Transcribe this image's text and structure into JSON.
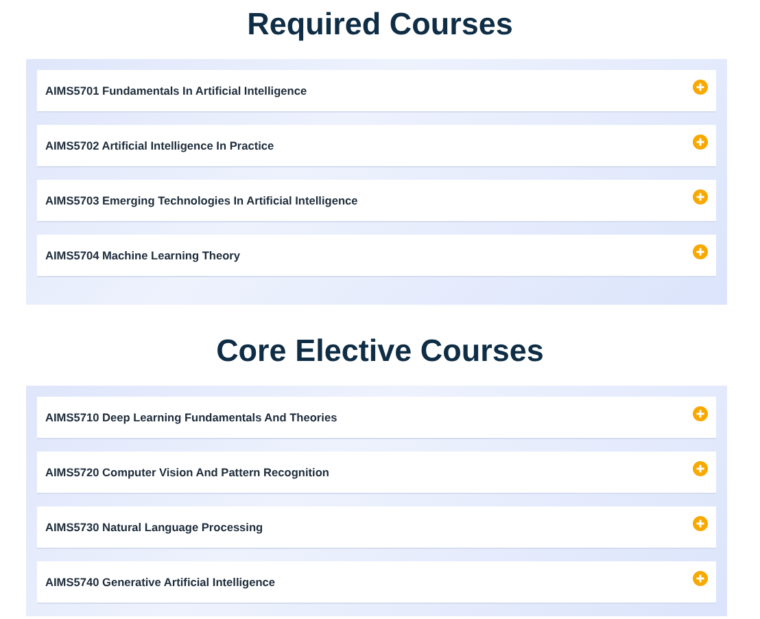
{
  "sections": [
    {
      "title": "Required Courses",
      "courses": [
        {
          "label": "AIMS5701 Fundamentals In Artificial Intelligence",
          "expanded": false
        },
        {
          "label": "AIMS5702 Artificial Intelligence In Practice",
          "expanded": false
        },
        {
          "label": "AIMS5703 Emerging Technologies In Artificial Intelligence",
          "expanded": false
        },
        {
          "label": "AIMS5704 Machine Learning Theory",
          "expanded": false
        }
      ]
    },
    {
      "title": "Core Elective Courses",
      "courses": [
        {
          "label": "AIMS5710 Deep Learning Fundamentals And Theories",
          "expanded": false
        },
        {
          "label": "AIMS5720 Computer Vision And Pattern Recognition",
          "expanded": false
        },
        {
          "label": "AIMS5730 Natural Language Processing",
          "expanded": false
        },
        {
          "label": "AIMS5740 Generative Artificial Intelligence",
          "expanded": false
        }
      ]
    }
  ]
}
